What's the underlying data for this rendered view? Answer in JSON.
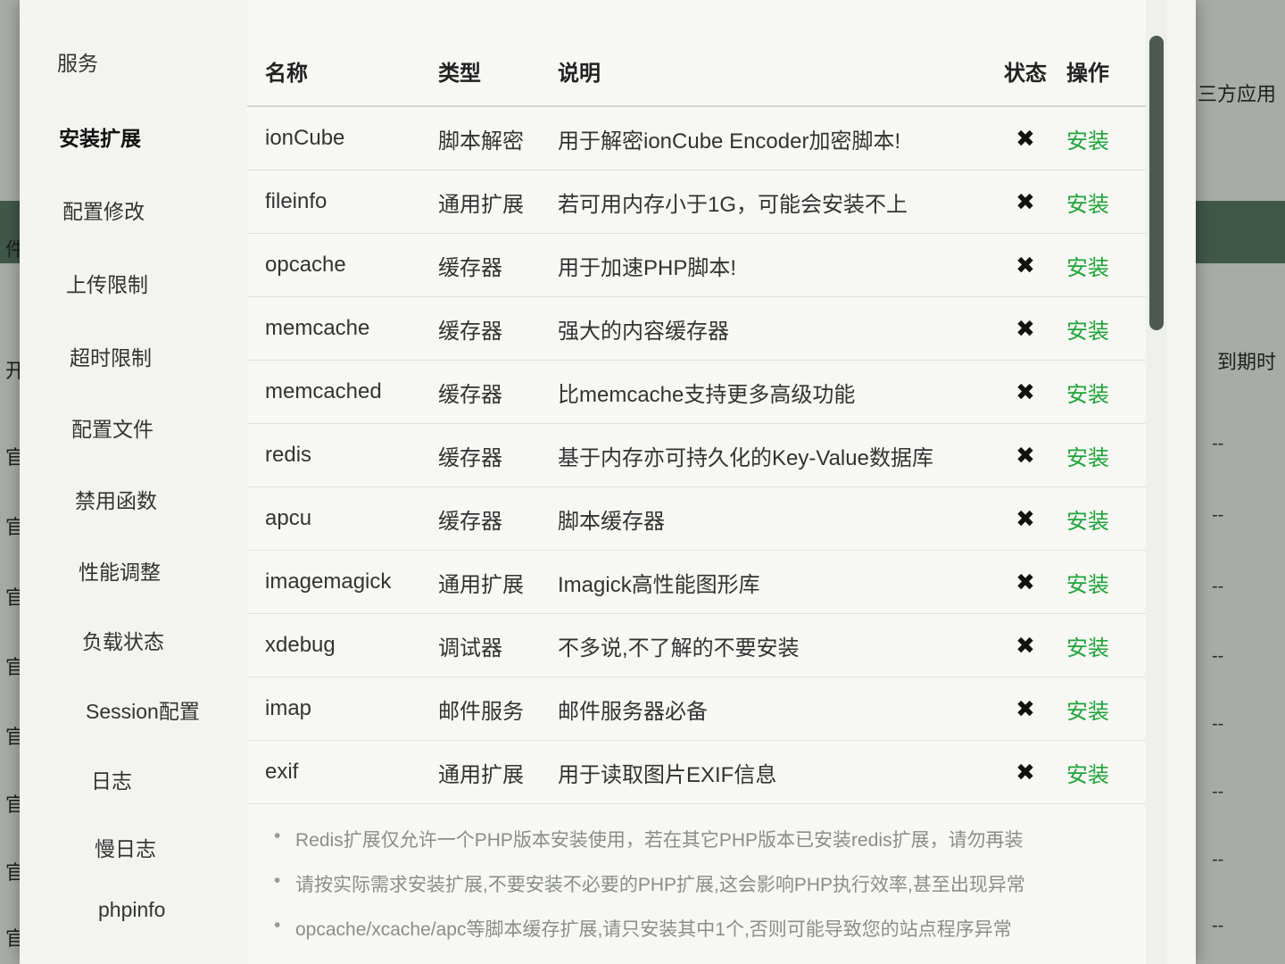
{
  "background": {
    "left_labels": [
      "开",
      "官",
      "官",
      "官",
      "官",
      "官",
      "官",
      "官",
      "官"
    ],
    "left_misc": [
      "件"
    ],
    "right_labels": [
      "三方应用",
      "到期时"
    ],
    "right_dashes": [
      "--",
      "--",
      "--",
      "--",
      "--",
      "--",
      "--",
      "--",
      "--"
    ]
  },
  "sidebar": {
    "items": [
      {
        "label": "服务"
      },
      {
        "label": "安装扩展"
      },
      {
        "label": "配置修改"
      },
      {
        "label": "上传限制"
      },
      {
        "label": "超时限制"
      },
      {
        "label": "配置文件"
      },
      {
        "label": "禁用函数"
      },
      {
        "label": "性能调整"
      },
      {
        "label": "负载状态"
      },
      {
        "label": "Session配置"
      },
      {
        "label": "日志"
      },
      {
        "label": "慢日志"
      },
      {
        "label": "phpinfo"
      }
    ]
  },
  "table": {
    "headers": {
      "name": "名称",
      "type": "类型",
      "desc": "说明",
      "status": "状态",
      "action": "操作"
    },
    "rows": [
      {
        "name": "ionCube",
        "type": "脚本解密",
        "desc": "用于解密ionCube Encoder加密脚本!",
        "status": "✖",
        "action": "安装"
      },
      {
        "name": "fileinfo",
        "type": "通用扩展",
        "desc": "若可用内存小于1G，可能会安装不上",
        "status": "✖",
        "action": "安装"
      },
      {
        "name": "opcache",
        "type": "缓存器",
        "desc": "用于加速PHP脚本!",
        "status": "✖",
        "action": "安装"
      },
      {
        "name": "memcache",
        "type": "缓存器",
        "desc": "强大的内容缓存器",
        "status": "✖",
        "action": "安装"
      },
      {
        "name": "memcached",
        "type": "缓存器",
        "desc": "比memcache支持更多高级功能",
        "status": "✖",
        "action": "安装"
      },
      {
        "name": "redis",
        "type": "缓存器",
        "desc": "基于内存亦可持久化的Key-Value数据库",
        "status": "✖",
        "action": "安装"
      },
      {
        "name": "apcu",
        "type": "缓存器",
        "desc": "脚本缓存器",
        "status": "✖",
        "action": "安装"
      },
      {
        "name": "imagemagick",
        "type": "通用扩展",
        "desc": "Imagick高性能图形库",
        "status": "✖",
        "action": "安装"
      },
      {
        "name": "xdebug",
        "type": "调试器",
        "desc": "不多说,不了解的不要安装",
        "status": "✖",
        "action": "安装"
      },
      {
        "name": "imap",
        "type": "邮件服务",
        "desc": "邮件服务器必备",
        "status": "✖",
        "action": "安装"
      },
      {
        "name": "exif",
        "type": "通用扩展",
        "desc": "用于读取图片EXIF信息",
        "status": "✖",
        "action": "安装"
      }
    ]
  },
  "notes": [
    "Redis扩展仅允许一个PHP版本安装使用，若在其它PHP版本已安装redis扩展，请勿再装",
    "请按实际需求安装扩展,不要安装不必要的PHP扩展,这会影响PHP执行效率,甚至出现异常",
    "opcache/xcache/apc等脚本缓存扩展,请只安装其中1个,否则可能导致您的站点程序异常"
  ],
  "colors": {
    "install": "#20a53a",
    "status_x": "#111111"
  }
}
